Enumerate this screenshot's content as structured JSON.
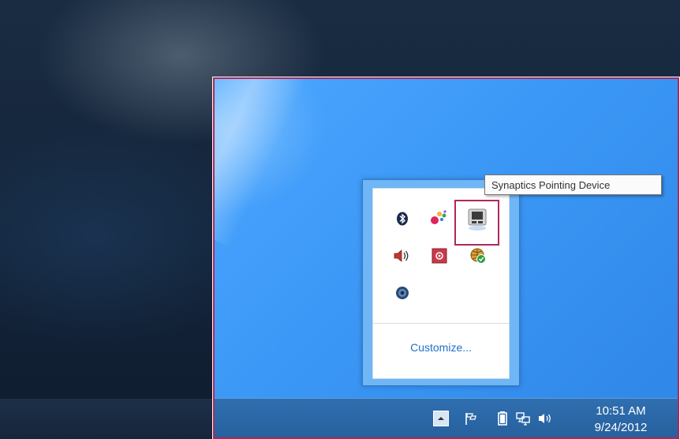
{
  "tooltip": {
    "text": "Synaptics Pointing Device"
  },
  "flyout": {
    "customize_label": "Customize...",
    "icons": [
      {
        "name": "bluetooth-icon"
      },
      {
        "name": "color-app-icon"
      },
      {
        "name": "synaptics-pointing-device-icon"
      },
      {
        "name": "speaker-icon"
      },
      {
        "name": "settings-app-icon"
      },
      {
        "name": "network-globe-check-icon"
      },
      {
        "name": "disc-app-icon"
      }
    ]
  },
  "taskbar": {
    "time": "10:51 AM",
    "date": "9/24/2012",
    "icons": [
      "show-hidden-icons-icon",
      "flag-icon",
      "battery-icon",
      "network-icon",
      "volume-icon"
    ]
  },
  "colors": {
    "highlight": "#b0285c",
    "desktop_blue": "#3b97f5",
    "link_blue": "#1d6fc9",
    "taskbar": "#27609d"
  }
}
